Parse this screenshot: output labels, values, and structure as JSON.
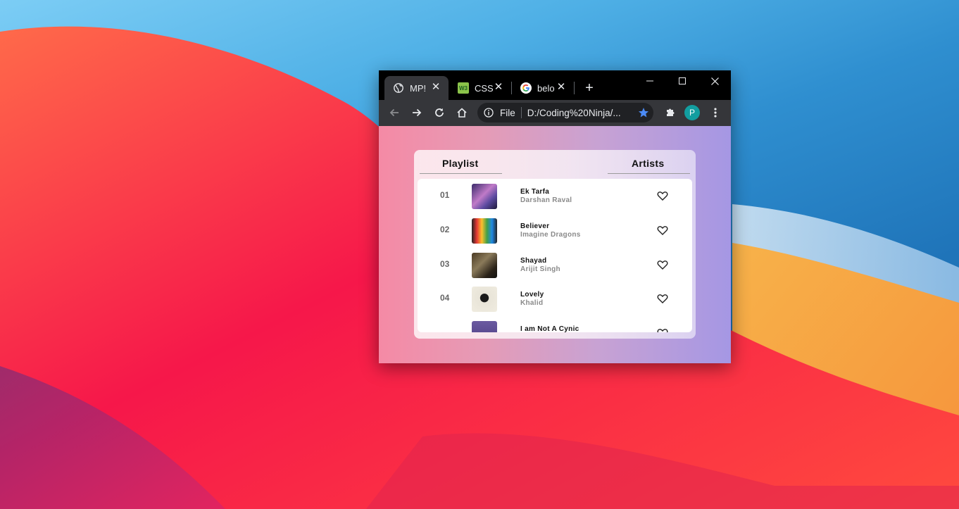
{
  "browser": {
    "tabs": [
      {
        "title": "MP!",
        "icon": "globe-icon",
        "active": true
      },
      {
        "title": "CSS",
        "icon": "css-site-icon",
        "active": false
      },
      {
        "title": "belo",
        "icon": "google-icon",
        "active": false
      }
    ],
    "new_tab_label": "+",
    "close_tab_label": "✕",
    "address": {
      "protocol_label": "File",
      "url": "D:/Coding%20Ninja/..."
    },
    "profile_initial": "P"
  },
  "music_app": {
    "playlist_header": "Playlist",
    "artists_header": "Artists",
    "tracks": [
      {
        "number": "01",
        "title": "Ek Tarfa",
        "artist": "Darshan Raval"
      },
      {
        "number": "02",
        "title": "Believer",
        "artist": "Imagine Dragons"
      },
      {
        "number": "03",
        "title": "Shayad",
        "artist": "Arijit Singh"
      },
      {
        "number": "04",
        "title": "Lovely",
        "artist": "Khalid"
      },
      {
        "number": "",
        "title": "I am Not A Cynic",
        "artist": ""
      }
    ]
  },
  "colors": {
    "accent_blue_star": "#4c8bf5",
    "avatar_bg": "#129ea0",
    "page_gradient_left": "#f58aa5",
    "page_gradient_right": "#a597e4"
  }
}
